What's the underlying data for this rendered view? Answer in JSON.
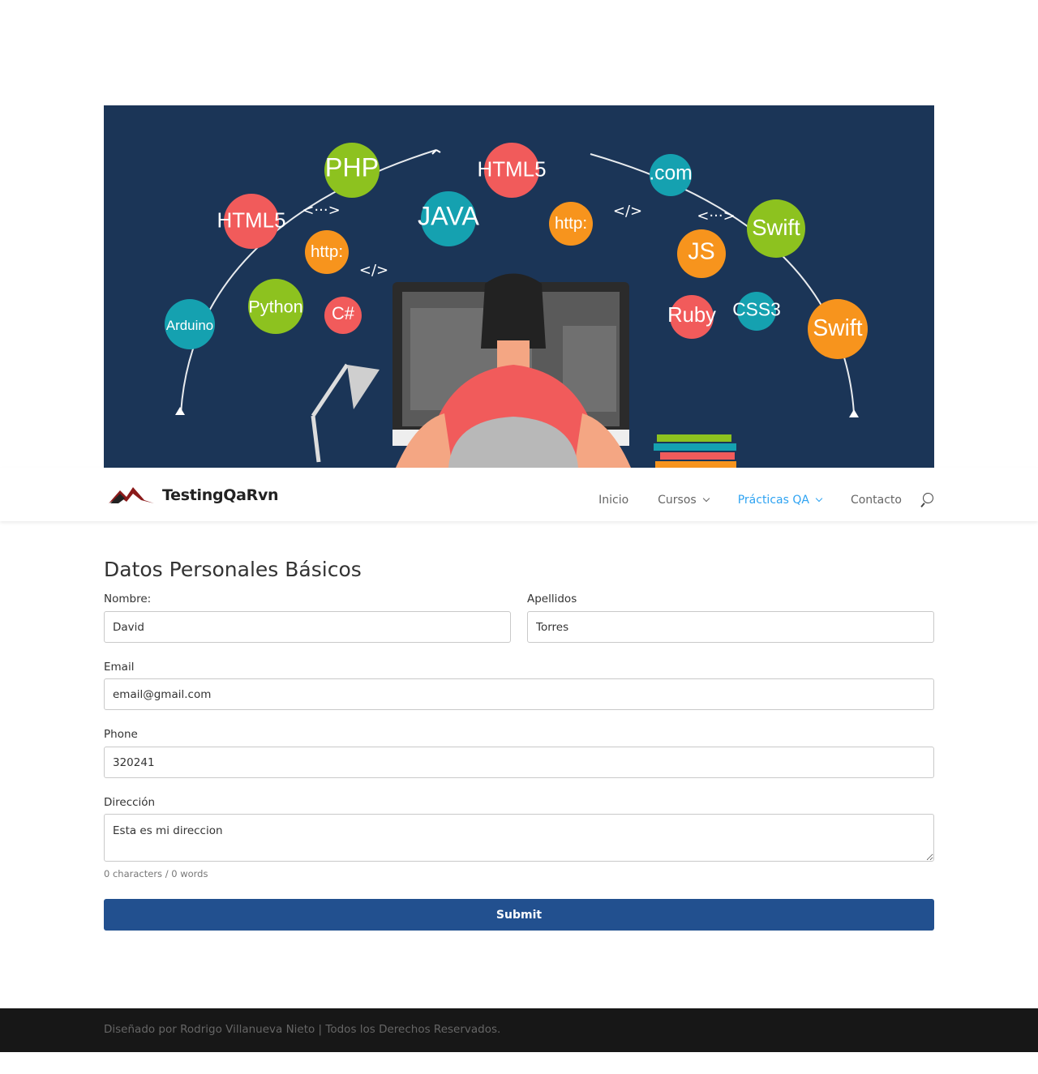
{
  "hero": {
    "bubbles": [
      {
        "text": "PHP",
        "color": "#8dc21f"
      },
      {
        "text": "HTML5",
        "color": "#f15b5b"
      },
      {
        "text": "HTML5",
        "color": "#f15b5b"
      },
      {
        "text": ".com",
        "color": "#15a1b0"
      },
      {
        "text": "JAVA",
        "color": "#15a1b0"
      },
      {
        "text": "http:",
        "color": "#f7941d"
      },
      {
        "text": "http:",
        "color": "#f7941d"
      },
      {
        "text": "Swift",
        "color": "#8dc21f"
      },
      {
        "text": "JS",
        "color": "#f7941d"
      },
      {
        "text": "Python",
        "color": "#8dc21f"
      },
      {
        "text": "Arduino",
        "color": "#15a1b0"
      },
      {
        "text": "C#",
        "color": "#f15b5b"
      },
      {
        "text": "Ruby",
        "color": "#f15b5b"
      },
      {
        "text": "CSS3",
        "color": "#15a1b0"
      },
      {
        "text": "Swift",
        "color": "#f7941d"
      }
    ],
    "code_tags": [
      "<···>",
      "</>",
      "</>",
      "<···>"
    ]
  },
  "nav": {
    "logo_text": "TestingQaRvn",
    "items": [
      {
        "label": "Inicio",
        "has_dropdown": false,
        "active": false
      },
      {
        "label": "Cursos",
        "has_dropdown": true,
        "active": false
      },
      {
        "label": "Prácticas QA",
        "has_dropdown": true,
        "active": true
      },
      {
        "label": "Contacto",
        "has_dropdown": false,
        "active": false
      }
    ],
    "active_color": "#2ea3f2"
  },
  "form": {
    "title": "Datos Personales Básicos",
    "nombre": {
      "label": "Nombre:",
      "value": "David"
    },
    "apellidos": {
      "label": "Apellidos",
      "value": "Torres"
    },
    "email": {
      "label": "Email",
      "value": "email@gmail.com"
    },
    "phone": {
      "label": "Phone",
      "value": "320241"
    },
    "direccion": {
      "label": "Dirección",
      "value": "Esta es mi direccion"
    },
    "counter": "0 characters / 0 words",
    "submit_label": "Submit",
    "submit_color": "#22508f"
  },
  "footer": {
    "text": "Diseñado por Rodrigo Villanueva Nieto | Todos los Derechos Reservados."
  }
}
